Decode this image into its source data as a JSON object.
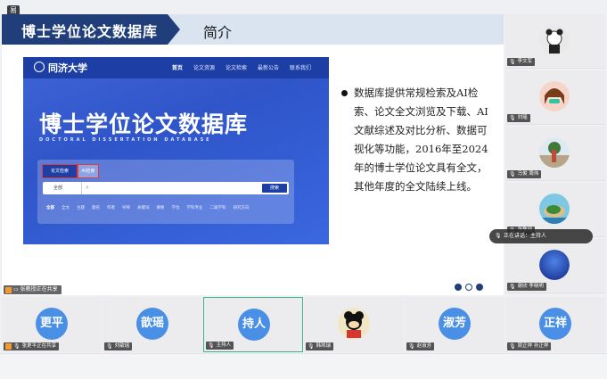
{
  "app": {
    "badge": "易"
  },
  "slide": {
    "title": "博士学位论文数据库",
    "subtitle": "简介",
    "bullet": "数据库提供常规检索及AI检索、论文全文浏览及下载、AI文献综述及对比分析、数据可视化等功能，2016年至2024年的博士学位论文具有全文，其他年度的全文陆续上线。",
    "pager": {
      "total": 3,
      "current": 2
    }
  },
  "site": {
    "logo": "同济大学",
    "menu": [
      "首页",
      "论文资源",
      "论文检索",
      "最新公告",
      "联系我们"
    ],
    "hero": "博士学位论文数据库",
    "hero_en": "DOCTORAL DISSERTATION DATABASE",
    "tab_regular": "论文检索",
    "tab_ai": "AI检索",
    "select": "全部",
    "search_btn": "搜索",
    "filters": [
      "全部",
      "全文",
      "主题",
      "题名",
      "作者",
      "导师",
      "关键词",
      "摘要",
      "学位",
      "学科专业",
      "二级学科",
      "研究方向"
    ]
  },
  "share_label": "张教授正在共享",
  "right_participants": [
    {
      "name": "李文军"
    },
    {
      "name": "刘瑶"
    },
    {
      "name": "马俊 周伟"
    },
    {
      "name": "张教授"
    },
    {
      "name": "谢欣 李晓明"
    }
  ],
  "speaking_toast": "正在讲话：主持人",
  "bottom_participants": [
    {
      "avatar": "更平",
      "name": "张更平正在共享"
    },
    {
      "avatar": "歆瑶",
      "name": "刘歆瑶"
    },
    {
      "avatar": "持人",
      "name": "主持人"
    },
    {
      "avatar": "",
      "name": "韩凯瑞"
    },
    {
      "avatar": "淑芳",
      "name": "赵淑芳"
    },
    {
      "avatar": "正祥",
      "name": "周正祥 孙正祥"
    }
  ]
}
